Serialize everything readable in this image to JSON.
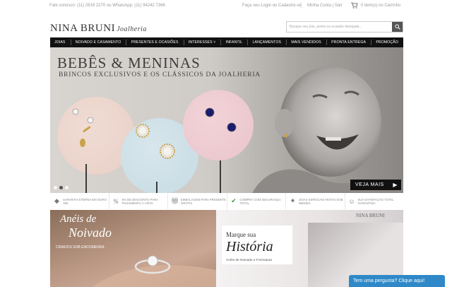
{
  "topbar": {
    "contact": "Fale conosco: (11) 2619 2270 ou WhatsApp: (11) 94242 7366",
    "login": "Faça seu Login ou Cadastre-se",
    "account": "Minha Conta | Sair",
    "cart": "0 item(s) no Carrinho"
  },
  "logo": {
    "brand": "NINA BRUNI",
    "script": "Joalheria"
  },
  "search": {
    "placeholder": "Busque seu jóia, pedra ou ocasião desejada..."
  },
  "nav": {
    "items": [
      "JOIAS",
      "NOIVADO E CASAMENTO",
      "PRESENTES E OCASIÕES",
      "INTERESSES ˅",
      "INFANTIL",
      "LANÇAMENTOS",
      "MAIS VENDIDOS",
      "PRONTA ENTREGA",
      "PROMOÇÃO"
    ]
  },
  "banner": {
    "title": "BEBÊS & MENINAS",
    "subtitle": "BRINCOS EXCLUSIVOS E OS CLÁSSICOS DA JOALHERIA",
    "cta": "VEJA MAIS",
    "slides_total": 3,
    "active_slide": 2
  },
  "benefits": [
    {
      "icon": "diamond-icon",
      "text": "GARANTIA ETERNA EM OURO 18K"
    },
    {
      "icon": "percent-icon",
      "text": "5% DE DESCONTO PARA PAGAMENTO À VISTA"
    },
    {
      "icon": "gift-icon",
      "text": "EMBALAGEM PARA PRESENTE GRÁTIS"
    },
    {
      "icon": "shield-check-icon",
      "text": "COMPRA COM SEGURANÇA TOTAL"
    },
    {
      "icon": "sparkle-icon",
      "text": "JOIAS ESPECIAIS FEITAS SOB MEDIDA"
    },
    {
      "icon": "satisfaction-icon",
      "text": "SUA SATISFAÇÃO TOTAL GARANTIDA"
    }
  ],
  "promos": {
    "left": {
      "title_line1": "Anéis de",
      "title_line2": "Noivado",
      "caption": "CRIADOS SOB ENCOMENDA"
    },
    "right": {
      "line1": "Marque sua",
      "line2": "História",
      "caption": "Anéis de Noivado e Formatura",
      "brand": "NINA BRUNI"
    }
  },
  "chat": {
    "label": "Tem uma pergunta? Clique aqui!"
  },
  "colors": {
    "nav_bg": "#111111",
    "chat_bg": "#2f89c8"
  }
}
